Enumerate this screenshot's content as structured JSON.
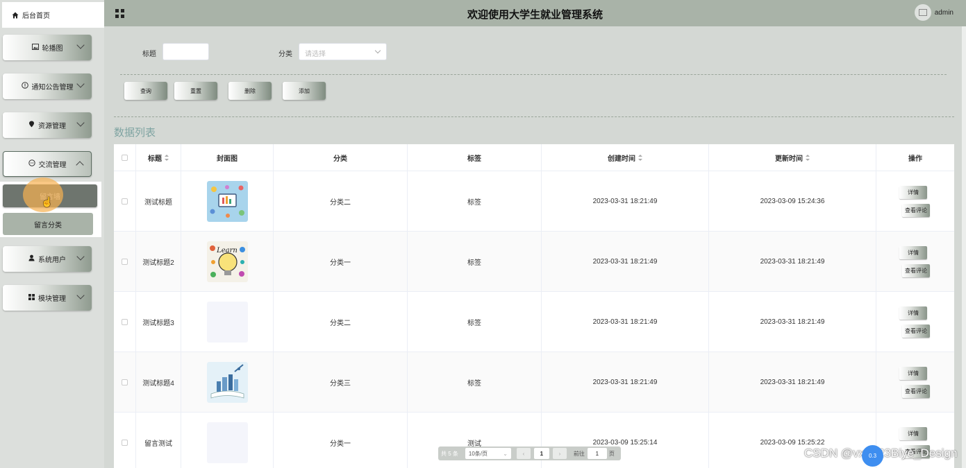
{
  "header": {
    "title": "欢迎使用大学生就业管理系统",
    "user": "admin"
  },
  "sidebar": {
    "home": "后台首页",
    "menus": [
      {
        "label": "轮播图",
        "icon": "image-icon"
      },
      {
        "label": "通知公告管理",
        "icon": "info-icon"
      },
      {
        "label": "资源管理",
        "icon": "pin-icon"
      },
      {
        "label": "交流管理",
        "icon": "chat-icon",
        "expanded": true
      },
      {
        "label": "系统用户",
        "icon": "user-icon"
      },
      {
        "label": "模块管理",
        "icon": "grid-icon"
      }
    ],
    "submenu": [
      "留言墙",
      "留言分类"
    ]
  },
  "search": {
    "title_label": "标题",
    "title_value": "",
    "category_label": "分类",
    "category_placeholder": "请选择"
  },
  "actions": {
    "query": "查询",
    "reset": "重置",
    "delete": "删除",
    "add": "添加"
  },
  "section_title": "数据列表",
  "table": {
    "columns": [
      "标题",
      "封面图",
      "分类",
      "标签",
      "创建时间",
      "更新时间",
      "操作"
    ],
    "rows": [
      {
        "title": "测试标题",
        "category": "分类二",
        "tag": "标签",
        "created": "2023-03-31 18:21:49",
        "updated": "2023-03-09 15:24:36",
        "cover": "infographic"
      },
      {
        "title": "测试标题2",
        "category": "分类一",
        "tag": "标签",
        "created": "2023-03-31 18:21:49",
        "updated": "2023-03-31 18:21:49",
        "cover": "learn-bulb"
      },
      {
        "title": "测试标题3",
        "category": "分类二",
        "tag": "标签",
        "created": "2023-03-31 18:21:49",
        "updated": "2023-03-31 18:21:49",
        "cover": "blank"
      },
      {
        "title": "测试标题4",
        "category": "分类三",
        "tag": "标签",
        "created": "2023-03-31 18:21:49",
        "updated": "2023-03-31 18:21:49",
        "cover": "book-city"
      },
      {
        "title": "留言测试",
        "category": "分类一",
        "tag": "测试",
        "created": "2023-03-09 15:25:14",
        "updated": "2023-03-09 15:25:22",
        "cover": "blank"
      }
    ],
    "row_actions": {
      "detail": "详情",
      "comments": "查看评论"
    }
  },
  "pagination": {
    "total": "共 5 条",
    "page_size": "10条/页",
    "current": "1",
    "goto": "前往",
    "goto_value": "1",
    "page_unit": "页"
  },
  "watermark": "CSDN @vx2023Biye_Design",
  "badge": "0.3"
}
